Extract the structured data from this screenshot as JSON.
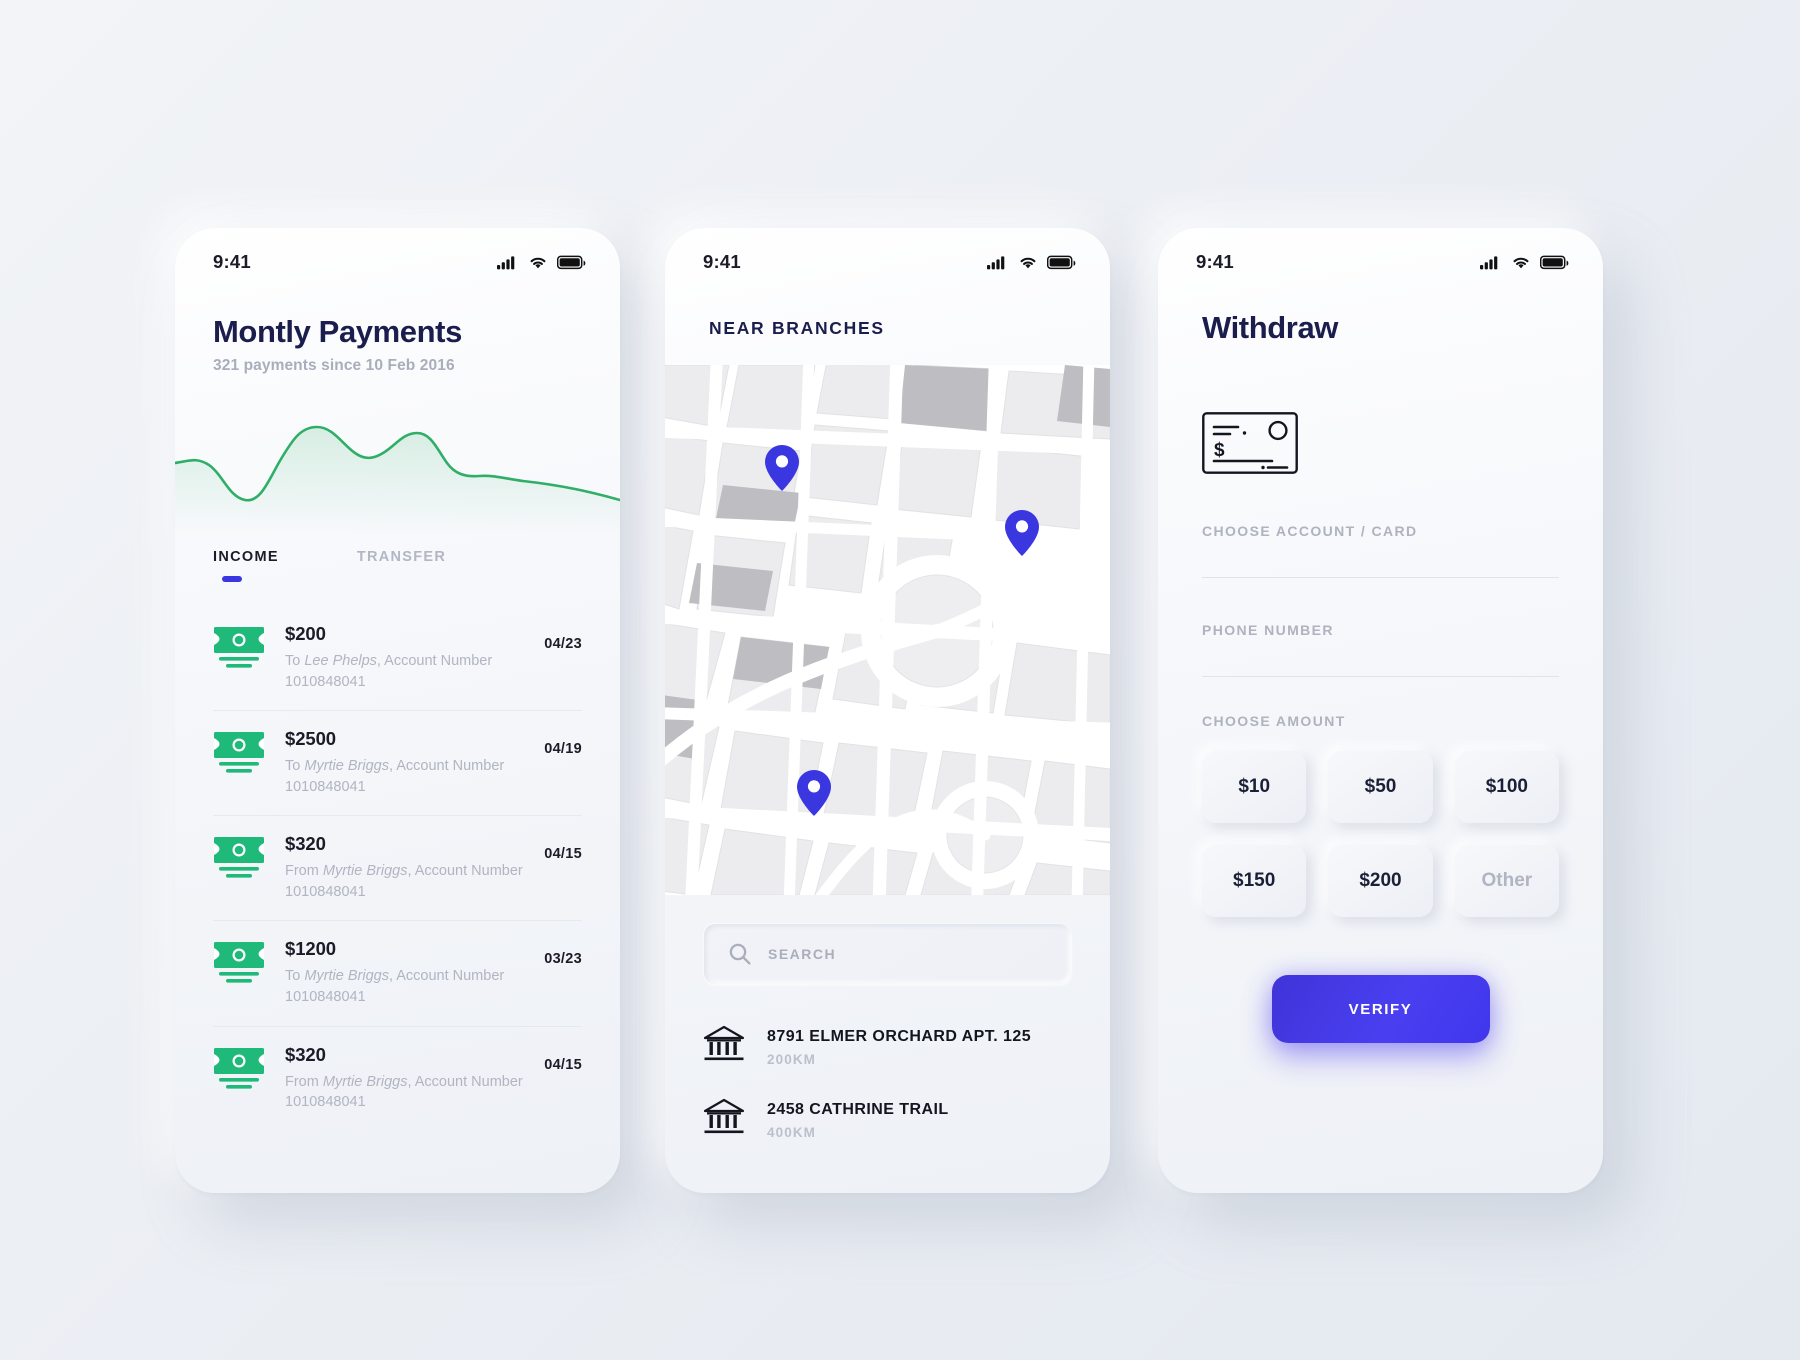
{
  "status_bar": {
    "time": "9:41",
    "icons": [
      "signal-icon",
      "wifi-icon",
      "battery-icon"
    ]
  },
  "screen_payments": {
    "title": "Montly Payments",
    "subtitle": "321 payments since 10 Feb 2016",
    "chart_accent": "#2fae68",
    "tabs": [
      {
        "label": "INCOME",
        "active": true
      },
      {
        "label": "TRANSFER",
        "active": false
      }
    ],
    "transactions": [
      {
        "amount": "$200",
        "direction": "To",
        "party": "Lee Phelps",
        "tail": ", Account Number 1010848041",
        "date": "04/23"
      },
      {
        "amount": "$2500",
        "direction": "To",
        "party": "Myrtie Briggs",
        "tail": ", Account Number 1010848041",
        "date": "04/19"
      },
      {
        "amount": "$320",
        "direction": "From",
        "party": "Myrtie Briggs",
        "tail": ", Account Number 1010848041",
        "date": "04/15"
      },
      {
        "amount": "$1200",
        "direction": "To",
        "party": "Myrtie Briggs",
        "tail": ", Account Number 1010848041",
        "date": "03/23"
      },
      {
        "amount": "$320",
        "direction": "From",
        "party": "Myrtie Briggs",
        "tail": ", Account Number 1010848041",
        "date": "04/15"
      }
    ]
  },
  "screen_branches": {
    "title": "NEAR BRANCHES",
    "pin_color": "#3a36e0",
    "map_pins": 3,
    "search": {
      "placeholder": "SEARCH",
      "value": ""
    },
    "branches": [
      {
        "name": "8791 ELMER ORCHARD APT. 125",
        "distance": "200KM"
      },
      {
        "name": "2458 CATHRINE TRAIL",
        "distance": "400KM"
      }
    ]
  },
  "screen_withdraw": {
    "title": "Withdraw",
    "check_icon": "cheque-icon",
    "fields": [
      {
        "label": "CHOOSE ACCOUNT / CARD",
        "value": ""
      },
      {
        "label": "PHONE NUMBER",
        "value": ""
      }
    ],
    "amount_label": "CHOOSE AMOUNT",
    "amounts": [
      {
        "label": "$10",
        "muted": false
      },
      {
        "label": "$50",
        "muted": false
      },
      {
        "label": "$100",
        "muted": false
      },
      {
        "label": "$150",
        "muted": false
      },
      {
        "label": "$200",
        "muted": false
      },
      {
        "label": "Other",
        "muted": true
      }
    ],
    "verify_label": "VERIFY",
    "verify_color": "#4036ec"
  },
  "chart_data": {
    "type": "line",
    "title": "Montly Payments",
    "series": [
      {
        "name": "payments",
        "values": [
          52,
          50,
          44,
          30,
          22,
          20,
          30,
          52,
          72,
          80,
          74,
          60,
          56,
          60,
          70,
          74,
          68,
          46,
          38,
          36,
          38,
          36,
          34
        ]
      }
    ],
    "x": [
      0,
      1,
      2,
      3,
      4,
      5,
      6,
      7,
      8,
      9,
      10,
      11,
      12,
      13,
      14,
      15,
      16,
      17,
      18,
      19,
      20,
      21,
      22
    ],
    "xlabel": "",
    "ylabel": "",
    "grid": false,
    "legend": false,
    "line_color": "#2fae68"
  }
}
